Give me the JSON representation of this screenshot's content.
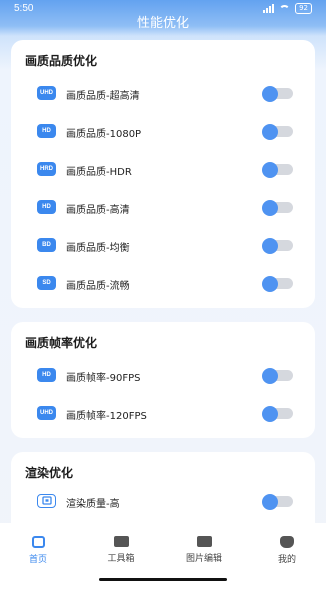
{
  "status": {
    "time": "5:50",
    "battery": "92"
  },
  "header": {
    "title": "性能优化"
  },
  "sections": [
    {
      "title": "画质品质优化",
      "items": [
        {
          "badge": "UHD",
          "label": "画质品质-超高清",
          "enabled": true
        },
        {
          "badge": "HD",
          "label": "画质品质-1080P",
          "enabled": true
        },
        {
          "badge": "HRD",
          "label": "画质品质-HDR",
          "enabled": true
        },
        {
          "badge": "HD",
          "label": "画质品质-高清",
          "enabled": true
        },
        {
          "badge": "BD",
          "label": "画质品质-均衡",
          "enabled": true
        },
        {
          "badge": "SD",
          "label": "画质品质-流畅",
          "enabled": true
        }
      ]
    },
    {
      "title": "画质帧率优化",
      "items": [
        {
          "badge": "HD",
          "label": "画质帧率-90FPS",
          "enabled": true
        },
        {
          "badge": "UHD",
          "label": "画质帧率-120FPS",
          "enabled": true
        }
      ]
    },
    {
      "title": "渲染优化",
      "items": [
        {
          "badge": "",
          "icon": "chip-icon",
          "label": "渲染质量-高",
          "enabled": true
        }
      ]
    }
  ],
  "tabs": [
    {
      "label": "首页",
      "icon": "home-icon",
      "active": true
    },
    {
      "label": "工具箱",
      "icon": "toolbox-icon",
      "active": false
    },
    {
      "label": "图片编辑",
      "icon": "image-icon",
      "active": false
    },
    {
      "label": "我的",
      "icon": "profile-icon",
      "active": false
    }
  ],
  "colors": {
    "accent": "#3b88ee",
    "header_blue": "#63a2f0",
    "toggle_track": "#d5d8de"
  }
}
